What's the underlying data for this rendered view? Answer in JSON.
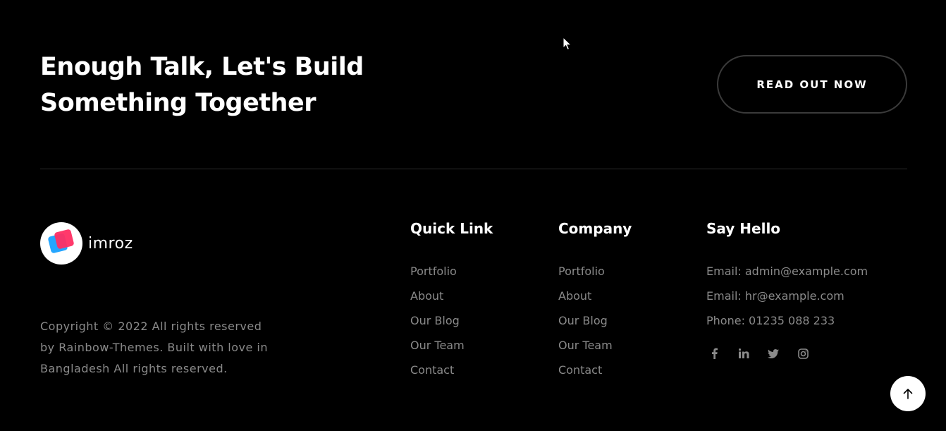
{
  "cta": {
    "title_line1": "Enough Talk, Let's Build",
    "title_line2": "Something Together",
    "button_label": "READ OUT NOW"
  },
  "brand": {
    "name": "imroz",
    "copyright_line1": "Copyright © 2022 All rights reserved",
    "copyright_line2": "by Rainbow-Themes. Built with love in",
    "copyright_line3": "Bangladesh All rights reserved."
  },
  "quick_link": {
    "title": "Quick Link",
    "items": [
      "Portfolio",
      "About",
      "Our Blog",
      "Our Team",
      "Contact"
    ]
  },
  "company": {
    "title": "Company",
    "items": [
      "Portfolio",
      "About",
      "Our Blog",
      "Our Team",
      "Contact"
    ]
  },
  "say_hello": {
    "title": "Say Hello",
    "items": [
      "Email: admin@example.com",
      "Email: hr@example.com",
      "Phone: 01235 088 233"
    ],
    "social_icons": [
      "facebook-icon",
      "linkedin-icon",
      "twitter-icon",
      "instagram-icon"
    ]
  },
  "back_to_top_icon": "arrow-up-icon",
  "colors": {
    "background": "#000000",
    "text": "#ffffff",
    "muted": "#8a8a8a",
    "divider": "#2b2b2b",
    "logo_blue": "#25a6ff",
    "logo_pink": "#ff2e63"
  }
}
